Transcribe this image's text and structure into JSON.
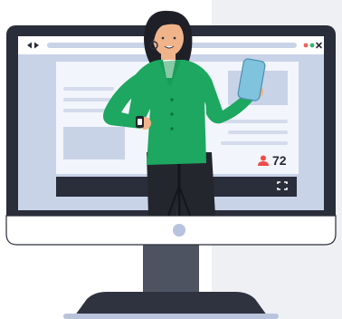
{
  "stream": {
    "viewer_count": "72",
    "viewer_icon": "user-icon",
    "fullscreen_icon": "expand-icon"
  },
  "browser": {
    "nav_icons": [
      "back-arrow-icon",
      "forward-arrow-icon"
    ],
    "window_dots": [
      "#f0605a",
      "#33b56b"
    ],
    "close_icon": "close-icon"
  },
  "colors": {
    "accent_green": "#1da760",
    "monitor_body": "#2a2d3a",
    "screen_bg": "#c9d3e8",
    "viewer_icon_red": "#ee4b4b"
  }
}
